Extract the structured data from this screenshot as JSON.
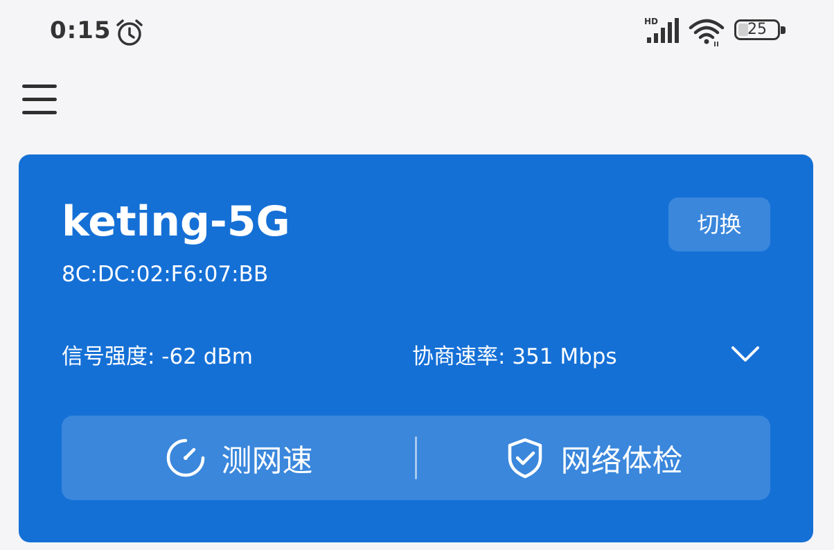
{
  "status_bar": {
    "time": "0:15",
    "alarm_icon": "alarm-clock-icon",
    "network_badge": "HD",
    "signal_icon": "cellular-signal-icon",
    "wifi_icon": "wifi-icon",
    "battery_level": "25",
    "battery_fraction": 0.25
  },
  "nav": {
    "menu_icon": "hamburger-menu-icon"
  },
  "wifi_card": {
    "accent_color": "#1570d6",
    "network_name": "keting-5G",
    "mac_address": "8C:DC:02:F6:07:BB",
    "switch_label": "切换",
    "signal_strength": "信号强度: -62 dBm",
    "negotiated_rate": "协商速率: 351 Mbps",
    "expand_icon": "chevron-down-icon",
    "actions": [
      {
        "label": "测网速",
        "icon": "speedometer-icon"
      },
      {
        "label": "网络体检",
        "icon": "shield-check-icon"
      }
    ]
  }
}
